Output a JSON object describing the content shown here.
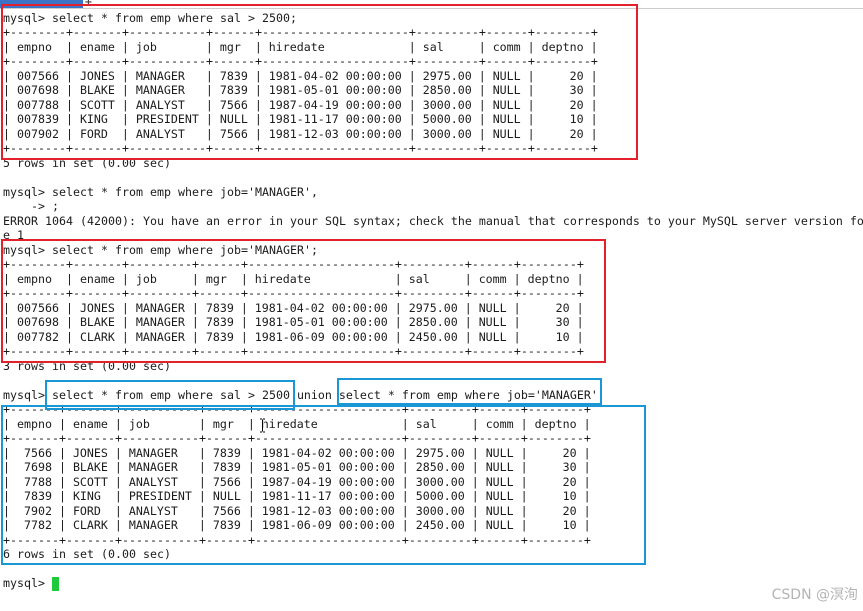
{
  "window": {
    "new_tab_label": "+"
  },
  "colors": {
    "background": "#ffffff",
    "text": "#1b1b1b",
    "cursor": "#1fc93c",
    "highlight_red": "#e2212c",
    "highlight_blue": "#1b97d6",
    "tab": "#3a74c9",
    "tab_rule": "#cccccc",
    "watermark": "#b3b3b3"
  },
  "terminal": {
    "prompt": "mysql>",
    "continuation_prompt": "->",
    "separator": "|",
    "blocks": [
      {
        "command": "select * from emp where sal > 2500;",
        "result": {
          "border": "+--------+-------+-----------+------+---------------------+---------+------+--------+",
          "columns": [
            "empno",
            "ename",
            "job",
            "mgr",
            "hiredate",
            "sal",
            "comm",
            "deptno"
          ],
          "rows": [
            [
              "007566",
              "JONES",
              "MANAGER",
              "7839",
              "1981-04-02 00:00:00",
              "2975.00",
              "NULL",
              "20"
            ],
            [
              "007698",
              "BLAKE",
              "MANAGER",
              "7839",
              "1981-05-01 00:00:00",
              "2850.00",
              "NULL",
              "30"
            ],
            [
              "007788",
              "SCOTT",
              "ANALYST",
              "7566",
              "1987-04-19 00:00:00",
              "3000.00",
              "NULL",
              "20"
            ],
            [
              "007839",
              "KING",
              "PRESIDENT",
              "NULL",
              "1981-11-17 00:00:00",
              "5000.00",
              "NULL",
              "10"
            ],
            [
              "007902",
              "FORD",
              "ANALYST",
              "7566",
              "1981-12-03 00:00:00",
              "3000.00",
              "NULL",
              "20"
            ]
          ],
          "footer": "5 rows in set (0.00 sec)"
        }
      },
      {
        "command": "select * from emp where job='MANAGER',",
        "continuation": ";",
        "error": "ERROR 1064 (42000): You have an error in your SQL syntax; check the manual that corresponds to your MySQL server version fo",
        "error_wrap": "e 1"
      },
      {
        "command": "select * from emp where job='MANAGER';",
        "result": {
          "border": "+--------+-------+---------+------+---------------------+---------+------+--------+",
          "columns": [
            "empno",
            "ename",
            "job",
            "mgr",
            "hiredate",
            "sal",
            "comm",
            "deptno"
          ],
          "rows": [
            [
              "007566",
              "JONES",
              "MANAGER",
              "7839",
              "1981-04-02 00:00:00",
              "2975.00",
              "NULL",
              "20"
            ],
            [
              "007698",
              "BLAKE",
              "MANAGER",
              "7839",
              "1981-05-01 00:00:00",
              "2850.00",
              "NULL",
              "30"
            ],
            [
              "007782",
              "CLARK",
              "MANAGER",
              "7839",
              "1981-06-09 00:00:00",
              "2450.00",
              "NULL",
              "10"
            ]
          ],
          "footer": "3 rows in set (0.00 sec)"
        }
      },
      {
        "command_parts": [
          "select * from emp where sal > 2500",
          "union",
          "select * from emp where job='MANAGER'"
        ],
        "result": {
          "border": "+-------+-------+-----------+------+---------------------+---------+------+--------+",
          "columns": [
            "empno",
            "ename",
            "job",
            "mgr",
            "hiredate",
            "sal",
            "comm",
            "deptno"
          ],
          "rows": [
            [
              "7566",
              "JONES",
              "MANAGER",
              "7839",
              "1981-04-02 00:00:00",
              "2975.00",
              "NULL",
              "20"
            ],
            [
              "7698",
              "BLAKE",
              "MANAGER",
              "7839",
              "1981-05-01 00:00:00",
              "2850.00",
              "NULL",
              "30"
            ],
            [
              "7788",
              "SCOTT",
              "ANALYST",
              "7566",
              "1987-04-19 00:00:00",
              "3000.00",
              "NULL",
              "20"
            ],
            [
              "7839",
              "KING",
              "PRESIDENT",
              "NULL",
              "1981-11-17 00:00:00",
              "5000.00",
              "NULL",
              "10"
            ],
            [
              "7902",
              "FORD",
              "ANALYST",
              "7566",
              "1981-12-03 00:00:00",
              "3000.00",
              "NULL",
              "20"
            ],
            [
              "7782",
              "CLARK",
              "MANAGER",
              "7839",
              "1981-06-09 00:00:00",
              "2450.00",
              "NULL",
              "10"
            ]
          ],
          "footer": "6 rows in set (0.00 sec)"
        }
      }
    ]
  },
  "watermark": "CSDN @溟洵"
}
